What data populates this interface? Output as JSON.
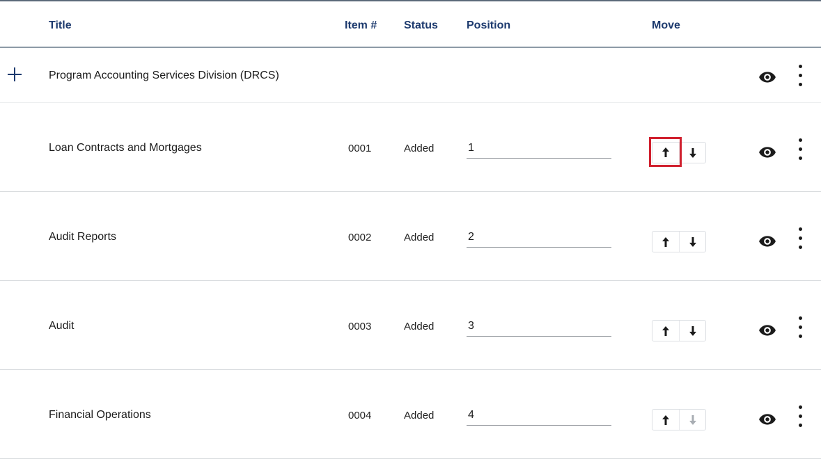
{
  "headers": {
    "title": "Title",
    "item_no": "Item #",
    "status": "Status",
    "position": "Position",
    "move": "Move"
  },
  "group": {
    "title": "Program Accounting Services Division (DRCS)"
  },
  "rows": [
    {
      "title": "Loan Contracts and Mortgages",
      "item_no": "0001",
      "status": "Added",
      "position": "1",
      "up_highlighted": true,
      "down_disabled": false
    },
    {
      "title": "Audit Reports",
      "item_no": "0002",
      "status": "Added",
      "position": "2",
      "up_highlighted": false,
      "down_disabled": false
    },
    {
      "title": "Audit",
      "item_no": "0003",
      "status": "Added",
      "position": "3",
      "up_highlighted": false,
      "down_disabled": false
    },
    {
      "title": "Financial Operations",
      "item_no": "0004",
      "status": "Added",
      "position": "4",
      "up_highlighted": false,
      "down_disabled": true
    }
  ],
  "icons": {
    "expand": "plus-icon",
    "preview": "eye-icon",
    "menu": "kebab-menu-icon",
    "move_up": "arrow-up-icon",
    "move_down": "arrow-down-icon"
  },
  "colors": {
    "header_text": "#1d3a6e",
    "highlight": "#d0202e"
  }
}
